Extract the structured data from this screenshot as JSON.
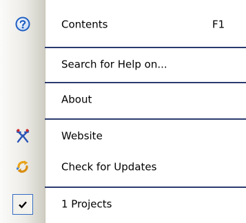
{
  "menu": {
    "items": [
      {
        "label": "Contents",
        "shortcut": "F1",
        "icon": "help-circle-icon"
      },
      {
        "label": "Search for Help on..."
      },
      {
        "label": "About"
      },
      {
        "label": "Website",
        "icon": "website-icon"
      },
      {
        "label": "Check for Updates",
        "icon": "check-updates-icon"
      },
      {
        "label": "1 Projects",
        "checked": true,
        "icon": "checkmark-icon"
      }
    ]
  },
  "colors": {
    "separator": "#2a3a6e",
    "help_icon": "#1f5fc1",
    "website_icon": "#2a55b7",
    "updates_icon": "#e8a31a",
    "check_frame": "#316ac5"
  }
}
